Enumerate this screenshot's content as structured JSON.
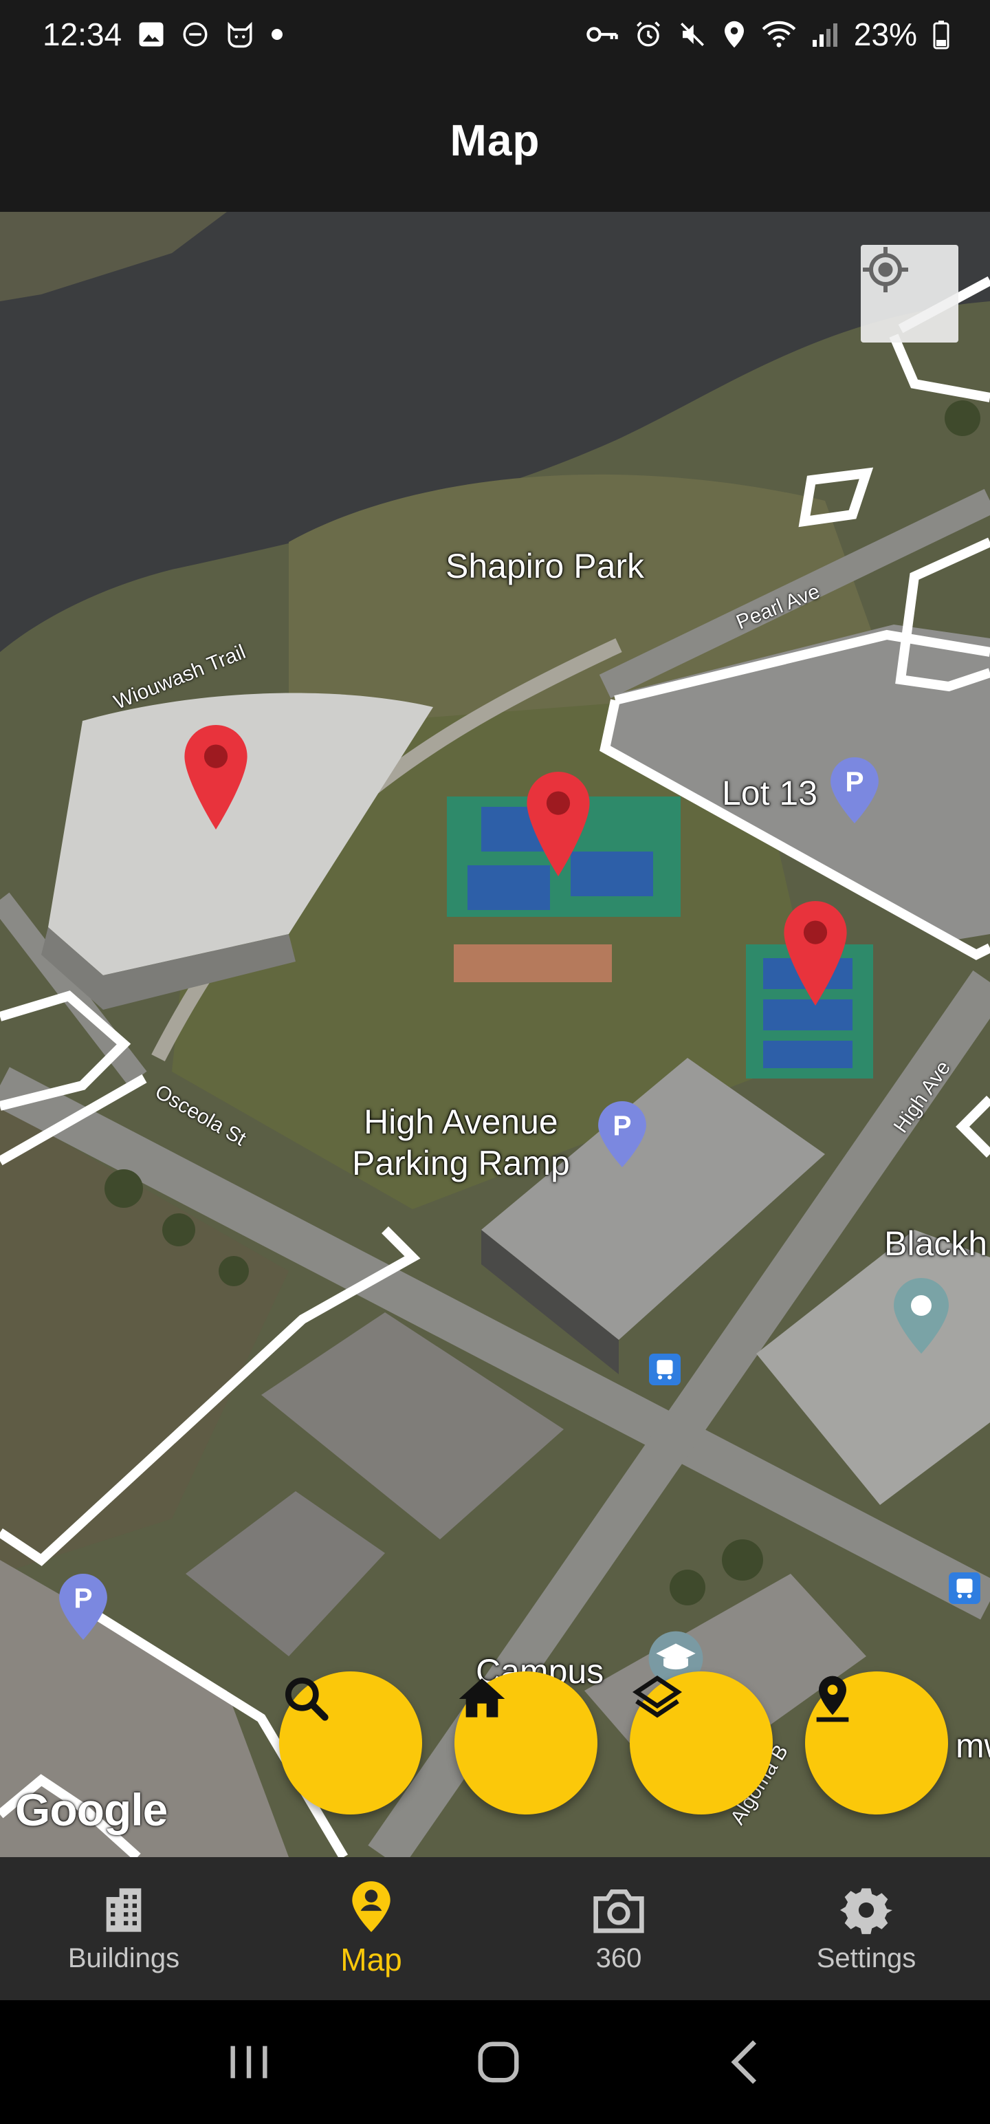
{
  "status_bar": {
    "time": "12:34",
    "battery": "23%",
    "left_icons": [
      "image-icon",
      "dnd-icon",
      "cat-icon",
      "dot-icon"
    ],
    "right_icons": [
      "key-icon",
      "alarm-icon",
      "mute-icon",
      "location-icon",
      "wifi-icon",
      "signal-icon",
      "battery-icon"
    ]
  },
  "app_bar": {
    "title": "Map"
  },
  "map": {
    "labels": {
      "park": "Shapiro Park",
      "lot": "Lot 13",
      "ramp": "High Avenue\nParking Ramp",
      "blackh": "Blackh",
      "campus": "Campus",
      "mw": "mw"
    },
    "streets": {
      "trail": "Wiouwash Trail",
      "pearl": "Pearl Ave",
      "osceola": "Osceola St",
      "high": "High Ave",
      "algoma": "Algoma B"
    },
    "attribution": "Google",
    "pin_color": "#e8333c",
    "parking_marker_color": "#7b88e0"
  },
  "fabs": [
    {
      "name": "search",
      "icon": "search-icon"
    },
    {
      "name": "home",
      "icon": "home-icon"
    },
    {
      "name": "layers",
      "icon": "layers-icon"
    },
    {
      "name": "pin",
      "icon": "pin-drop-icon"
    }
  ],
  "bottom_nav": {
    "items": [
      {
        "label": "Buildings",
        "icon": "buildings-icon",
        "active": false
      },
      {
        "label": "Map",
        "icon": "map-pin-icon",
        "active": true
      },
      {
        "label": "360",
        "icon": "camera-icon",
        "active": false
      },
      {
        "label": "Settings",
        "icon": "gear-icon",
        "active": false
      }
    ]
  },
  "colors": {
    "accent": "#fbc80a",
    "bar": "#1a1a1a",
    "nav": "#2a2a2a"
  }
}
